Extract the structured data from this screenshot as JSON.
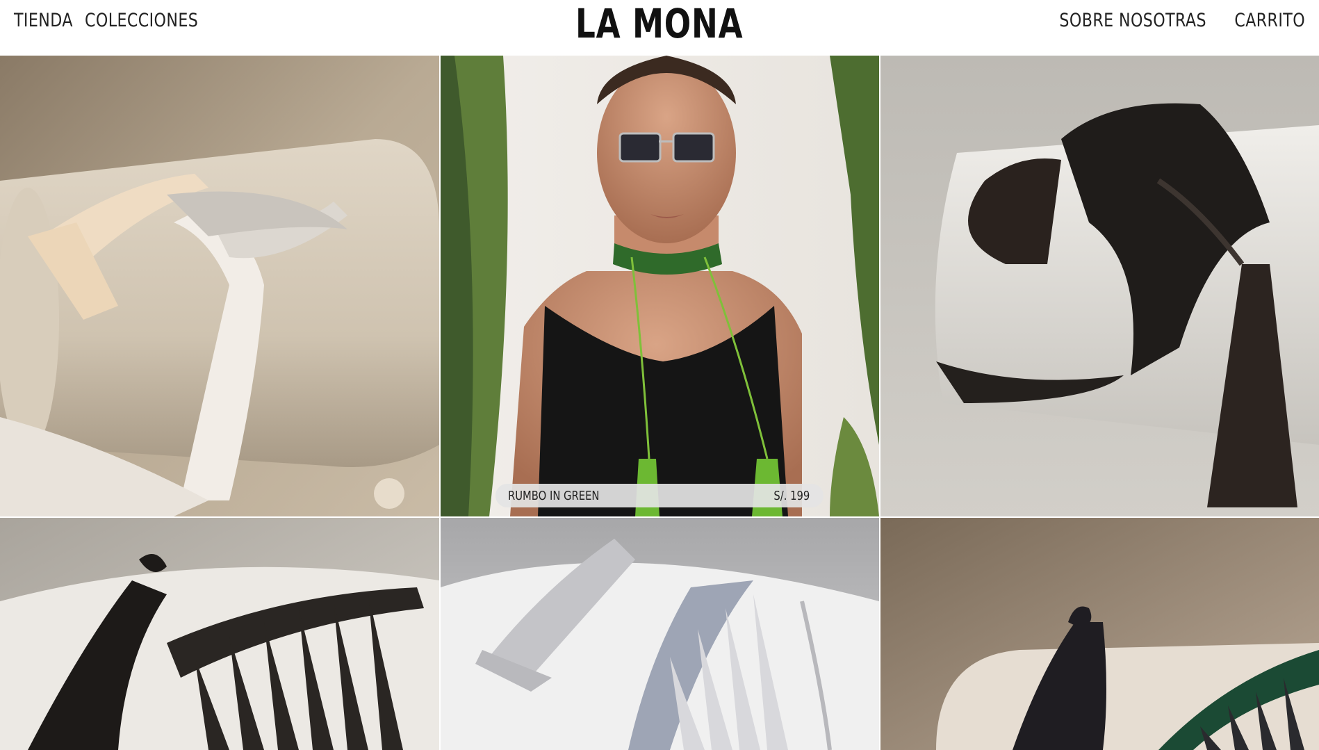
{
  "header": {
    "nav_left": [
      "TIENDA",
      "COLECCIONES"
    ],
    "logo": "LA MONA",
    "nav_right": [
      "SOBRE NOSOTRAS",
      "CARRITO"
    ]
  },
  "products": [
    {
      "image": "white beaded necklace with cream tassel on beige cylinder"
    },
    {
      "image": "model with sunglasses wearing green beaded choker with tassels",
      "name": "RUMBO IN GREEN",
      "price": "S/. 199"
    },
    {
      "image": "black beaded necklace with black tassels on white cylinder"
    },
    {
      "image": "black fringed beaded necklace with tassel on white cylinder"
    },
    {
      "image": "grey fringed beaded necklace with grey tassel on white cylinder"
    },
    {
      "image": "dark tassel with green beaded fringe on cylinder"
    }
  ],
  "colors": {
    "background": "#ffffff",
    "text": "#111111",
    "pill": "#e4e4e4"
  }
}
